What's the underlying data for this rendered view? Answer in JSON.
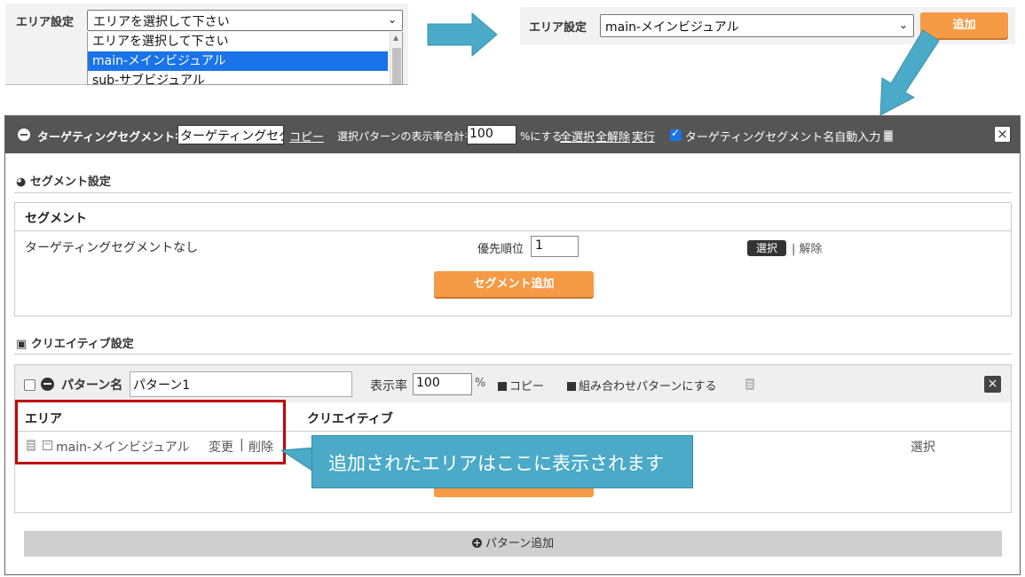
{
  "top_left": {
    "label": "エリア設定",
    "select_value": "エリアを選択して下さい",
    "options": [
      "エリアを選択して下さい",
      "main-メインビジュアル",
      "sub-サブビジュアル"
    ],
    "selected_index": 1
  },
  "top_right": {
    "label": "エリア設定",
    "select_value": "main-メインビジュアル",
    "add_label": "追加"
  },
  "header": {
    "seg_name_label": "ターゲティングセグメント名",
    "seg_name_value": "ターゲティングセグ",
    "copy_label": "コピー",
    "rate_prefix": "選択パターンの表示率合計を",
    "rate_value": "100",
    "rate_suffix": "%にする",
    "select_all": "全選択",
    "clear_all": "全解除",
    "execute": "実行",
    "auto_name_label": "ターゲティングセグメント名自動入力",
    "close": "×"
  },
  "segment_section": {
    "title": "セグメント設定",
    "box_title": "セグメント",
    "row_label": "ターゲティングセグメントなし",
    "priority_label": "優先順位",
    "priority_value": "1",
    "select_label": "選択",
    "unselect_label": "解除",
    "add_label": "セグメント追加"
  },
  "creative_section": {
    "title": "クリエイティブ設定",
    "pattern_label": "パターン名",
    "pattern_value": "パターン1",
    "display_rate_label": "表示率",
    "display_rate_value": "100",
    "percent": "%",
    "copy_label": "コピー",
    "combo_label": "組み合わせパターンにする",
    "close": "×",
    "col_area": "エリア",
    "col_creative": "クリエイティブ",
    "area_name": "main-メインビジュアル",
    "area_minus": "−",
    "area_change": "変更",
    "area_pipe": "|",
    "area_delete": "削除",
    "creative_select": "選択",
    "add_pattern": "パターン追加"
  },
  "callout": {
    "text": "追加されたエリアはここに表示されます"
  },
  "colors": {
    "accent_orange": "#f59a45",
    "header_gray": "#555555",
    "callout_blue": "#4aaac8",
    "highlight_red": "#c00000"
  }
}
